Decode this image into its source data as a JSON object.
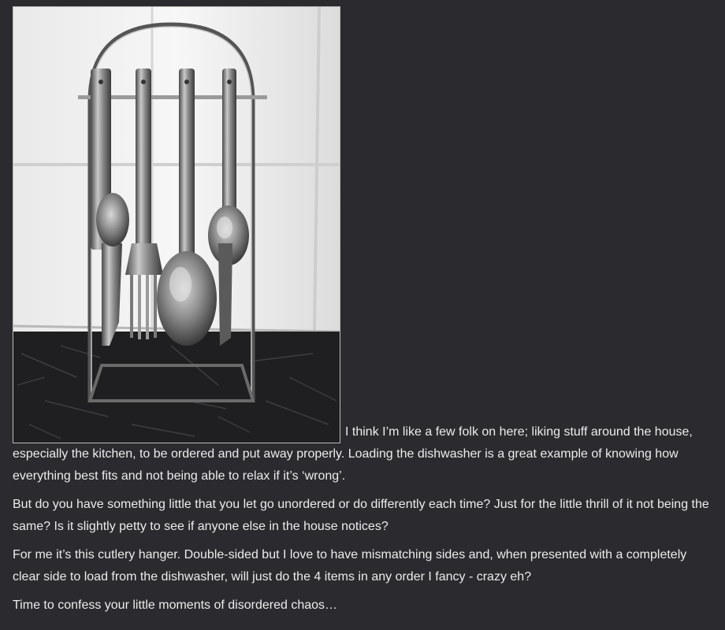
{
  "post": {
    "image": {
      "subject": "cutlery-hanger-photo"
    },
    "paragraphs": [
      "I think I’m like a few folk on here; liking stuff around the house, especially the kitchen, to be ordered and put away properly. Loading the dishwasher is a great example of knowing how everything best fits and not being able to relax if it’s ‘wrong’.",
      "But do you have something little that you let go unordered or do differently each time? Just for the little thrill of it not being the same? Is it slightly petty to see if anyone else in the house notices?",
      "For me it’s this cutlery hanger. Double-sided but I love to have mismatching sides and, when presented with a completely clear side to load from the dishwasher, will just do the 4 items in any order I fancy - crazy eh?",
      "Time to confess your little moments of disordered chaos…"
    ]
  },
  "colors": {
    "background": "#2b2b2f",
    "text": "#ececec",
    "photo_border": "#bdbdbd"
  }
}
